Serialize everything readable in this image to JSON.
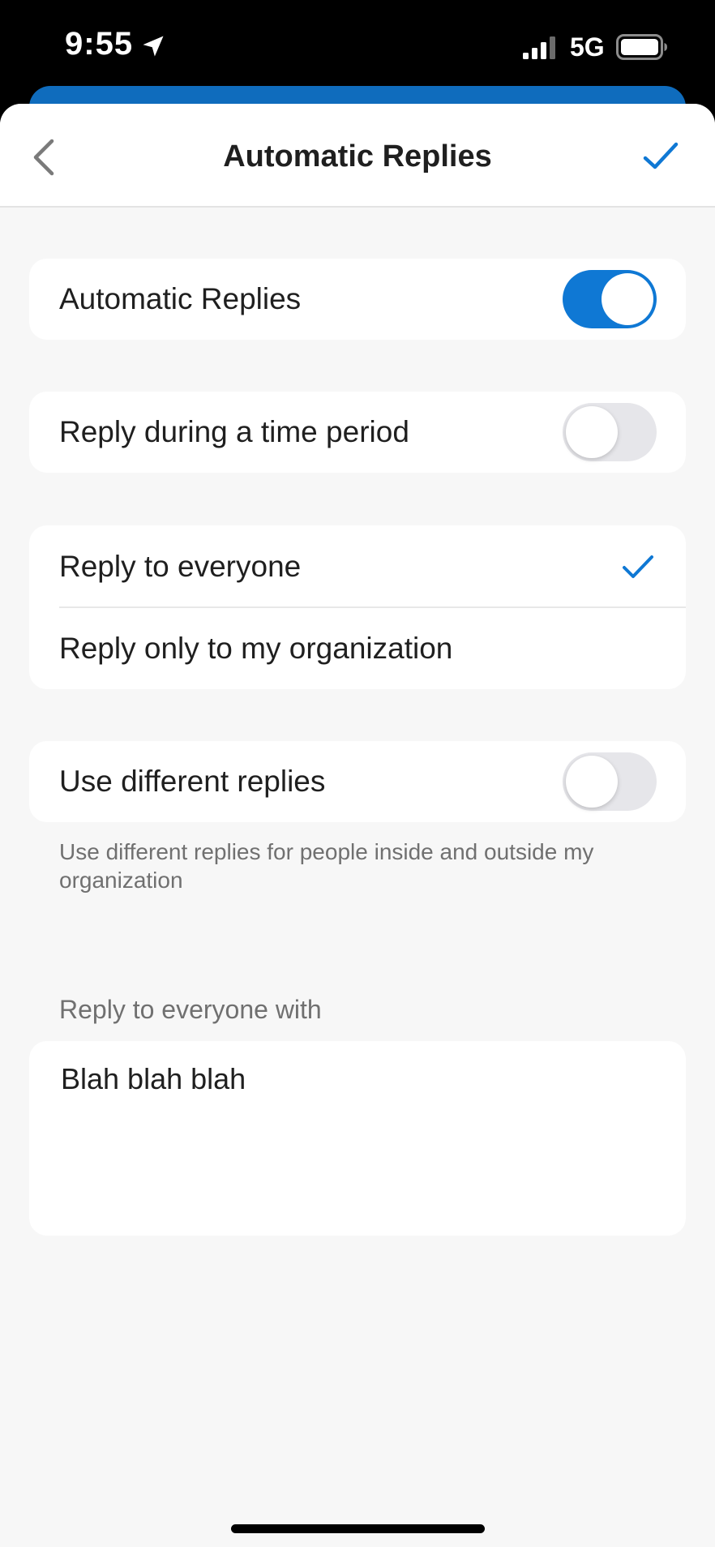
{
  "status_bar": {
    "time": "9:55",
    "network": "5G",
    "location_icon": "location-arrow-icon",
    "signal_icon": "cellular-signal-icon",
    "battery_icon": "battery-icon"
  },
  "nav": {
    "title": "Automatic Replies",
    "back_icon": "chevron-left-icon",
    "done_icon": "checkmark-icon"
  },
  "settings": {
    "automatic_replies": {
      "label": "Automatic Replies",
      "enabled": true
    },
    "time_period": {
      "label": "Reply during a time period",
      "enabled": false
    },
    "audience": {
      "options": [
        {
          "label": "Reply to everyone",
          "selected": true
        },
        {
          "label": "Reply only to my organization",
          "selected": false
        }
      ]
    },
    "different_replies": {
      "label": "Use different replies",
      "enabled": false,
      "description": "Use different replies for people inside and outside my organization"
    }
  },
  "reply_section": {
    "header": "Reply to everyone with",
    "message": "Blah blah blah"
  },
  "colors": {
    "accent": "#0f78d4",
    "background": "#f7f7f7",
    "toggle_off": "#e6e6ea"
  }
}
